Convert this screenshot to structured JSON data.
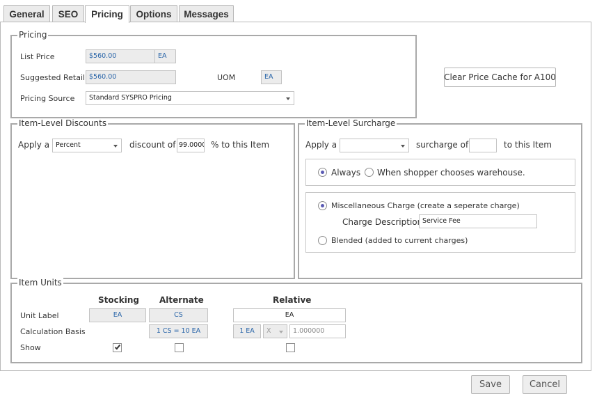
{
  "tabs": [
    "General",
    "SEO",
    "Pricing",
    "Options",
    "Messages"
  ],
  "pricing": {
    "legend": "Pricing",
    "list_price_label": "List Price",
    "list_price_value": "$560.00",
    "list_price_uom": "EA",
    "suggested_retail_label": "Suggested Retail",
    "suggested_retail_value": "$560.00",
    "uom_label": "UOM",
    "uom_value": "EA",
    "pricing_source_label": "Pricing Source",
    "pricing_source_value": "Standard SYSPRO Pricing"
  },
  "clear_cache_button": "Clear Price Cache for A100",
  "discounts": {
    "legend": "Item-Level Discounts",
    "apply_a": "Apply a",
    "type_value": "Percent",
    "discount_of": "discount of",
    "amount_value": "99.0000",
    "suffix": "% to this Item"
  },
  "surcharge": {
    "legend": "Item-Level Surcharge",
    "apply_a": "Apply a",
    "type_value": "",
    "surcharge_of": "surcharge of",
    "amount_value": "",
    "suffix": "to this Item",
    "always_label": "Always",
    "always_selected": true,
    "warehouse_label": "When shopper chooses warehouse.",
    "warehouse_selected": false,
    "misc_label": "Miscellaneous Charge (create a seperate charge)",
    "misc_selected": true,
    "charge_desc_label": "Charge Description:",
    "charge_desc_value": "Service Fee",
    "blended_label": "Blended (added to current charges)",
    "blended_selected": false
  },
  "units": {
    "legend": "Item Units",
    "col_stocking": "Stocking",
    "col_alternate": "Alternate",
    "col_relative": "Relative",
    "row_unit_label": "Unit Label",
    "row_calc_basis": "Calculation Basis",
    "row_show": "Show",
    "stocking_unit": "EA",
    "alternate_unit": "CS",
    "relative_unit": "EA",
    "alternate_calc": "1 CS = 10 EA",
    "relative_calc_unit": "EA",
    "relative_calc_unit_prefix": "1 EA",
    "relative_operator": "X",
    "relative_factor": "1.000000",
    "show_stocking": true,
    "show_alternate": false,
    "show_relative": false
  },
  "footer": {
    "save": "Save",
    "cancel": "Cancel"
  },
  "colors": {
    "value_text": "#2864a8",
    "radio_selected": "#5b5bb4",
    "border": "#a9a9a9"
  }
}
